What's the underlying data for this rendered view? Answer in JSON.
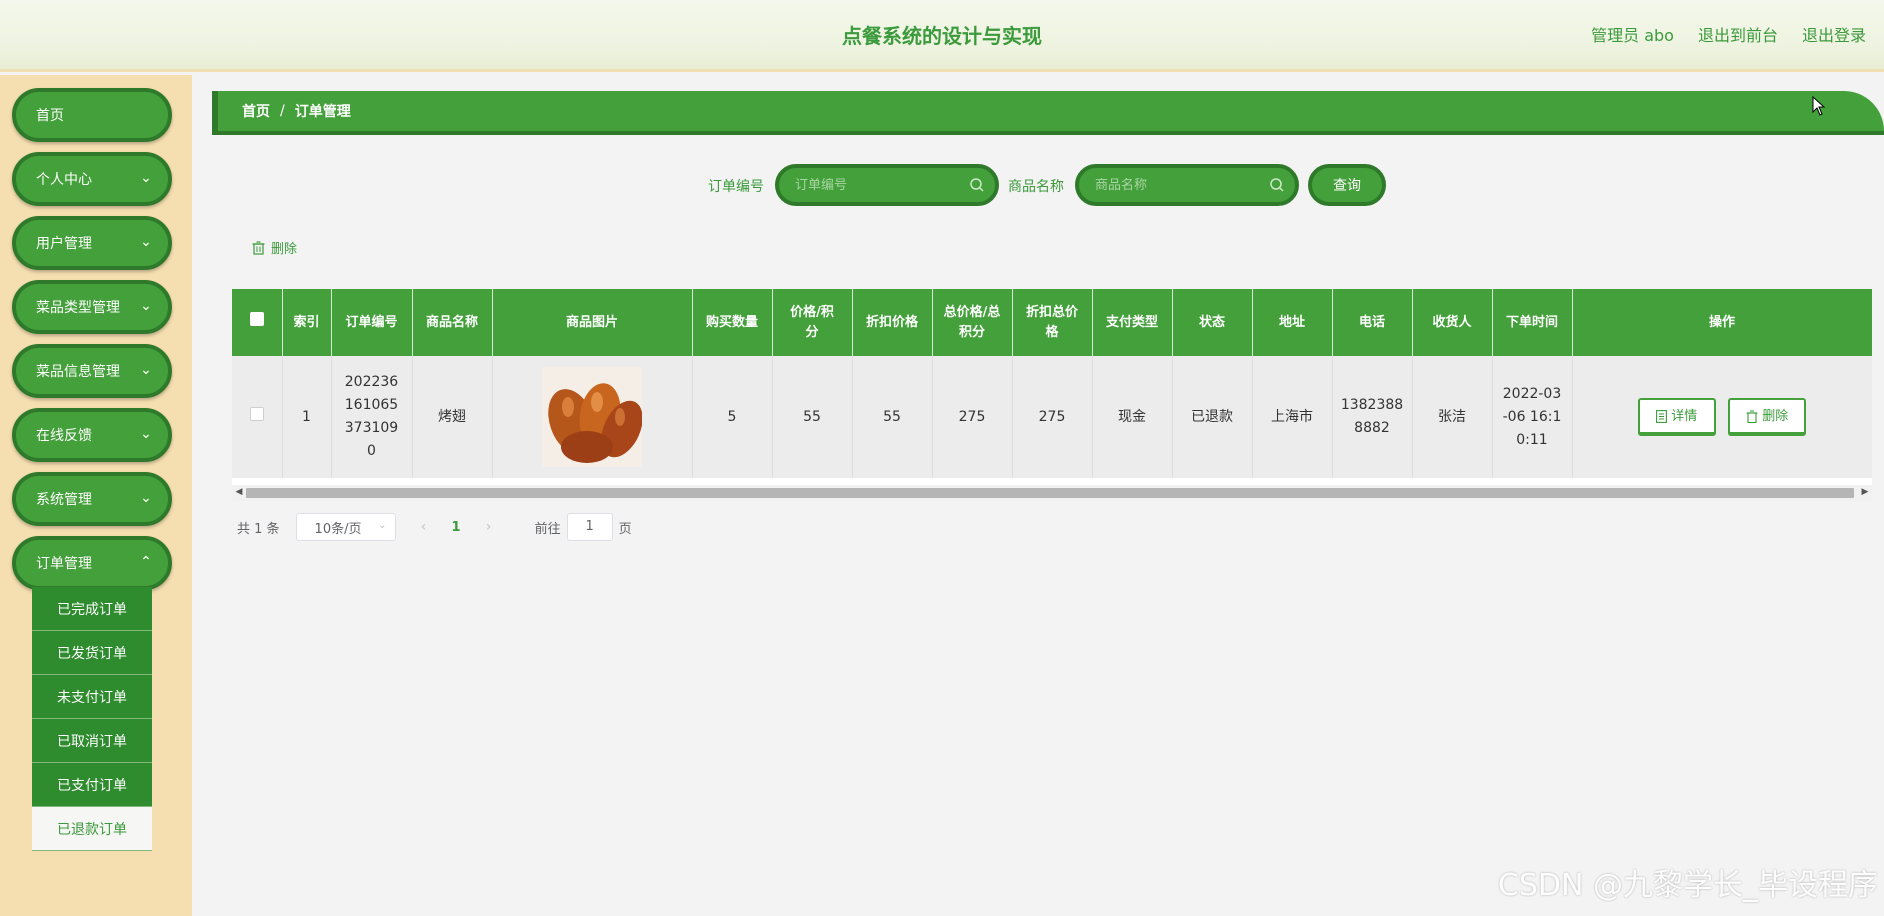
{
  "header": {
    "title": "点餐系统的设计与实现",
    "admin_label": "管理员 abo",
    "exit_front_label": "退出到前台",
    "logout_label": "退出登录"
  },
  "sidebar": {
    "items": [
      {
        "label": "首页"
      },
      {
        "label": "个人中心"
      },
      {
        "label": "用户管理"
      },
      {
        "label": "菜品类型管理"
      },
      {
        "label": "菜品信息管理"
      },
      {
        "label": "在线反馈"
      },
      {
        "label": "系统管理"
      },
      {
        "label": "订单管理"
      }
    ],
    "submenu": [
      {
        "label": "已完成订单"
      },
      {
        "label": "已发货订单"
      },
      {
        "label": "未支付订单"
      },
      {
        "label": "已取消订单"
      },
      {
        "label": "已支付订单"
      },
      {
        "label": "已退款订单"
      }
    ]
  },
  "breadcrumb": {
    "home": "首页",
    "separator": "/",
    "current": "订单管理"
  },
  "search": {
    "order_no_label": "订单编号",
    "order_no_placeholder": "订单编号",
    "product_label": "商品名称",
    "product_placeholder": "商品名称",
    "query_label": "查询"
  },
  "toolbar": {
    "delete_label": "删除"
  },
  "table": {
    "headers": {
      "index": "索引",
      "order_no": "订单编号",
      "product_name": "商品名称",
      "product_image": "商品图片",
      "quantity": "购买数量",
      "price": "价格/积分",
      "discount_price": "折扣价格",
      "total": "总价格/总积分",
      "discount_total": "折扣总价格",
      "pay_type": "支付类型",
      "status": "状态",
      "address": "地址",
      "phone": "电话",
      "receiver": "收货人",
      "order_time": "下单时间",
      "actions": "操作"
    },
    "rows": [
      {
        "index": "1",
        "order_no": "2022361610653731090",
        "product_name": "烤翅",
        "quantity": "5",
        "price": "55",
        "discount_price": "55",
        "total": "275",
        "discount_total": "275",
        "pay_type": "现金",
        "status": "已退款",
        "address": "上海市",
        "phone": "13823888882",
        "receiver": "张洁",
        "order_time": "2022-03-06 16:10:11",
        "detail_label": "详情",
        "delete_label": "删除"
      }
    ]
  },
  "pagination": {
    "total_text": "共 1 条",
    "page_size": "10条/页",
    "current_page": "1",
    "goto_label": "前往",
    "goto_value": "1",
    "page_suffix": "页"
  },
  "watermark": "CSDN @九黎学长_毕设程序",
  "colors": {
    "accent": "#43a03a",
    "accent_dark": "#2e7a2a",
    "sidebar_bg": "#f5deb0"
  }
}
